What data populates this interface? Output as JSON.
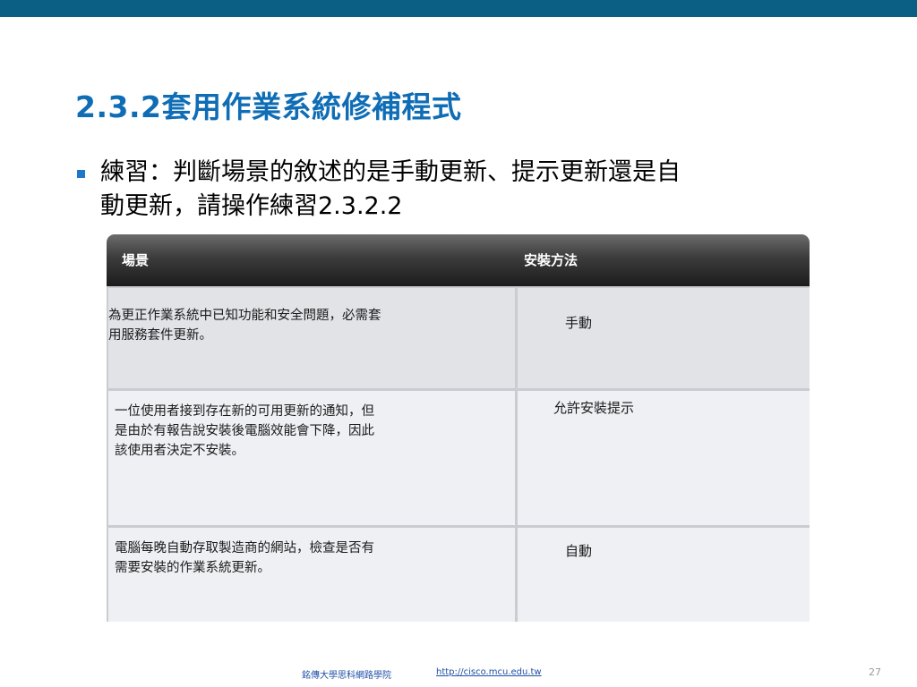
{
  "slide": {
    "title": "2.3.2套用作業系統修補程式",
    "bullet_lines": [
      "練習：判斷場景的敘述的是手動更新、提示更新還是自",
      "動更新，請操作練習2.3.2.2"
    ]
  },
  "table": {
    "headers": [
      "場景",
      "安裝方法"
    ],
    "rows": [
      {
        "scenario_lines": [
          "為更正作業系統中已知功能和安全問題，必需套",
          "用服務套件更新。"
        ],
        "method": "手動"
      },
      {
        "scenario_lines": [
          "一位使用者接到存在新的可用更新的通知，但",
          "是由於有報告說安裝後電腦效能會下降，因此",
          "該使用者決定不安裝。"
        ],
        "method": "允許安裝提示"
      },
      {
        "scenario_lines": [
          "電腦每晚自動存取製造商的網站，檢查是否有",
          "需要安裝的作業系統更新。"
        ],
        "method": "自動"
      }
    ]
  },
  "footer": {
    "organization": "銘傳大學思科網路學院",
    "url": "http://cisco.mcu.edu.tw",
    "page_number": "27"
  },
  "colors": {
    "top_bar": "#0b5f85",
    "title": "#0f6db5",
    "bullet": "#1f77c9",
    "footer_link": "#1f4ea6"
  }
}
